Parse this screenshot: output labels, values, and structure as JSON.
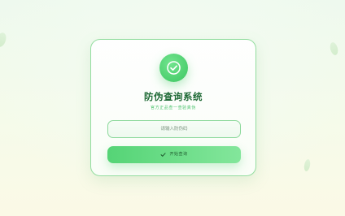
{
  "header": {
    "title": "防伪查询系统",
    "subtitle": "官方正品查一查验真伪"
  },
  "search": {
    "placeholder": "请输入防伪码",
    "value": ""
  },
  "action": {
    "label": "开始查询"
  },
  "icons": {
    "badge": "check-circle-icon",
    "button": "check-icon"
  },
  "colors": {
    "accent": "#4ccf6e",
    "title": "#1f6a36",
    "subtitle": "#4bc36c",
    "border": "#93dd9f"
  }
}
